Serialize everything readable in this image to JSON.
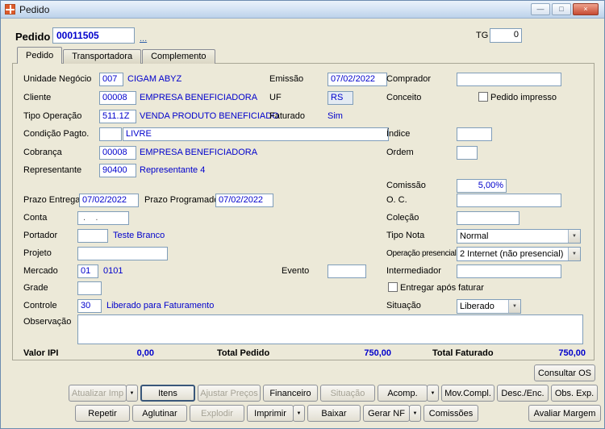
{
  "window": {
    "title": "Pedido"
  },
  "icons": {
    "minimize": "—",
    "maximize": "□",
    "close": "×",
    "dropdown": "▼",
    "combo_arrow": "▼",
    "lookup": "..."
  },
  "header": {
    "pedido_label": "Pedido",
    "pedido_value": "00011505",
    "tg_label": "TG",
    "tg_value": "0"
  },
  "tabs": [
    {
      "label": "Pedido",
      "active": true
    },
    {
      "label": "Transportadora",
      "active": false
    },
    {
      "label": "Complemento",
      "active": false
    }
  ],
  "fields": {
    "unidade_negocio": {
      "label": "Unidade Negócio",
      "code": "007",
      "desc": "CIGAM ABYZ"
    },
    "emissao": {
      "label": "Emissão",
      "value": "07/02/2022"
    },
    "comprador": {
      "label": "Comprador",
      "value": ""
    },
    "cliente": {
      "label": "Cliente",
      "code": "00008",
      "desc": "EMPRESA BENEFICIADORA"
    },
    "uf": {
      "label": "UF",
      "value": "RS"
    },
    "conceito": {
      "label": "Conceito"
    },
    "pedido_impresso": {
      "label": "Pedido impresso",
      "checked": false
    },
    "tipo_operacao": {
      "label": "Tipo Operação",
      "code": "511.1Z",
      "desc": "VENDA PRODUTO BENEFICIADO"
    },
    "faturado": {
      "label": "Faturado",
      "value": "Sim"
    },
    "condicao_pagto": {
      "label": "Condição Pagto.",
      "code": "",
      "desc": "LIVRE"
    },
    "indice": {
      "label": "Índice",
      "value": ""
    },
    "cobranca": {
      "label": "Cobrança",
      "code": "00008",
      "desc": "EMPRESA BENEFICIADORA"
    },
    "ordem": {
      "label": "Ordem",
      "value": ""
    },
    "representante": {
      "label": "Representante",
      "code": "90400",
      "desc": "Representante 4"
    },
    "comissao": {
      "label": "Comissão",
      "value": "5,00%"
    },
    "prazo_entrega": {
      "label": "Prazo Entrega",
      "value": "07/02/2022"
    },
    "prazo_programado": {
      "label": "Prazo Programado",
      "value": "07/02/2022"
    },
    "oc": {
      "label": "O. C.",
      "value": ""
    },
    "conta": {
      "label": "Conta",
      "value": " .    . "
    },
    "colecao": {
      "label": "Coleção",
      "value": ""
    },
    "portador": {
      "label": "Portador",
      "code": "",
      "desc": "Teste Branco"
    },
    "tipo_nota": {
      "label": "Tipo Nota",
      "value": "Normal"
    },
    "projeto": {
      "label": "Projeto",
      "value": ""
    },
    "operacao_presencial": {
      "label": "Operação presencial",
      "value": "2 Internet (não presencial)"
    },
    "mercado": {
      "label": "Mercado",
      "code": "01",
      "desc": "0101"
    },
    "evento": {
      "label": "Evento",
      "value": ""
    },
    "intermediador": {
      "label": "Intermediador",
      "value": ""
    },
    "grade": {
      "label": "Grade",
      "value": ""
    },
    "entregar_apos_faturar": {
      "label": "Entregar após faturar",
      "checked": false
    },
    "controle": {
      "label": "Controle",
      "code": "30",
      "desc": "Liberado para Faturamento"
    },
    "situacao": {
      "label": "Situação",
      "value": "Liberado"
    },
    "observacao": {
      "label": "Observação",
      "value": ""
    }
  },
  "totals": {
    "valor_ipi_label": "Valor IPI",
    "valor_ipi": "0,00",
    "total_pedido_label": "Total Pedido",
    "total_pedido": "750,00",
    "total_faturado_label": "Total Faturado",
    "total_faturado": "750,00"
  },
  "buttons": {
    "consultar_os": "Consultar OS",
    "row1": [
      {
        "label": "Atualizar Imp",
        "disabled": true,
        "split": true
      },
      {
        "label": "Itens",
        "disabled": false,
        "default": true
      },
      {
        "label": "Ajustar Preços",
        "disabled": true
      },
      {
        "label": "Financeiro",
        "disabled": false
      },
      {
        "label": "Situação",
        "disabled": true
      },
      {
        "label": "Acomp.",
        "disabled": false,
        "split": true
      },
      {
        "label": "Mov.Compl.",
        "disabled": false
      },
      {
        "label": "Desc./Enc.",
        "disabled": false
      },
      {
        "label": "Obs. Exp.",
        "disabled": false
      }
    ],
    "row2": [
      {
        "label": "Repetir",
        "disabled": false
      },
      {
        "label": "Aglutinar",
        "disabled": false
      },
      {
        "label": "Explodir",
        "disabled": true
      },
      {
        "label": "Imprimir",
        "disabled": false,
        "split": true
      },
      {
        "label": "Baixar",
        "disabled": false
      },
      {
        "label": "Gerar NF",
        "disabled": false,
        "split": true
      },
      {
        "label": "Comissões",
        "disabled": false
      },
      {
        "label": "Avaliar Margem",
        "disabled": false
      }
    ]
  }
}
